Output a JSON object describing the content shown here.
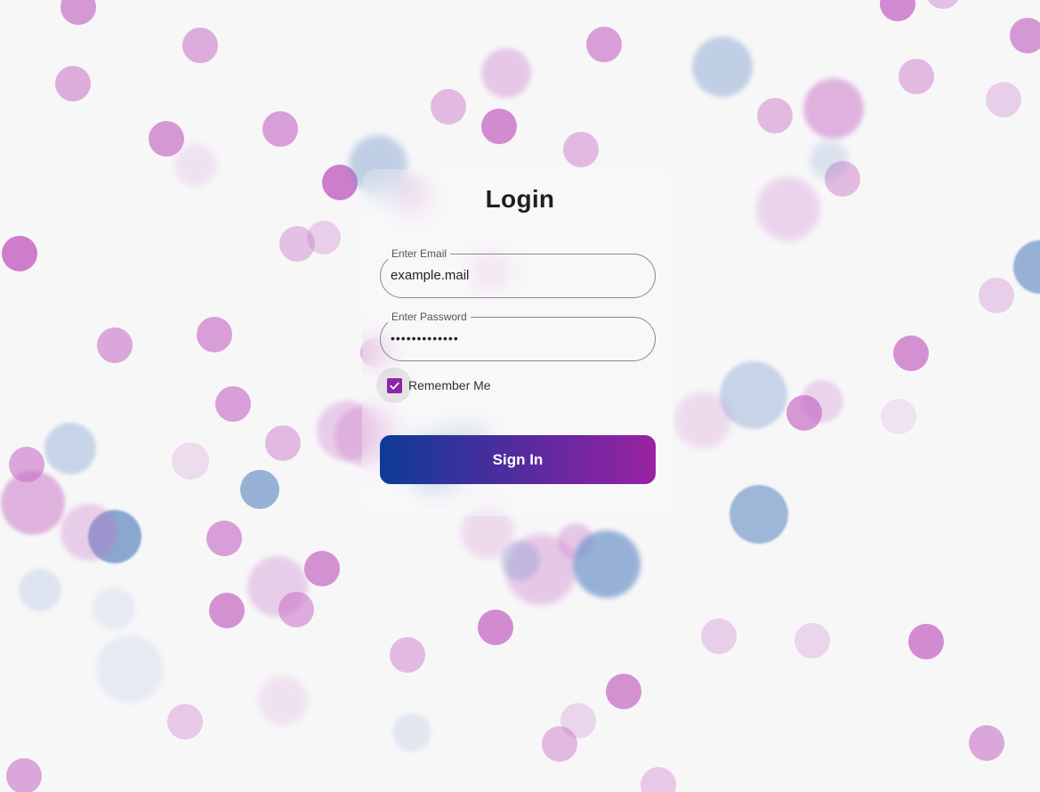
{
  "login": {
    "title": "Login",
    "email": {
      "label": "Enter Email",
      "value": "example.mail"
    },
    "password": {
      "label": "Enter Password",
      "value": "•••••••••••••"
    },
    "remember": {
      "label": "Remember Me",
      "checked": true
    },
    "signin_label": "Sign In"
  },
  "colors": {
    "accent_purple": "#8e24aa",
    "gradient_start": "#0d3b96",
    "gradient_end": "#9a22a2",
    "bubble_pink": "#c86fc6",
    "bubble_blue": "#6f94c8"
  }
}
